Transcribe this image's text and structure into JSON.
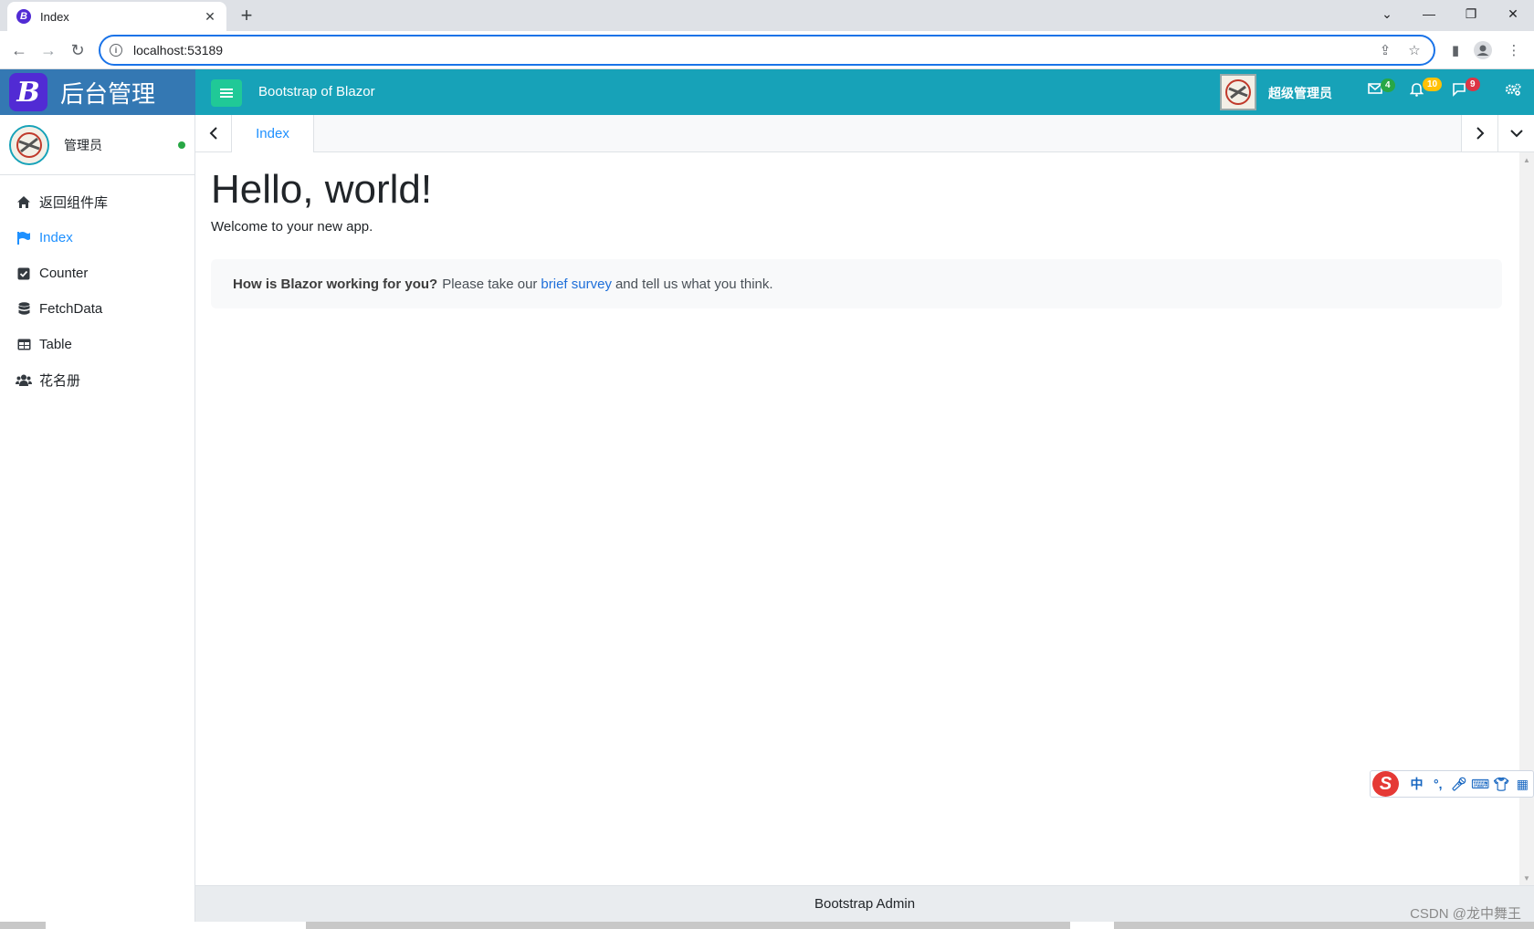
{
  "browser": {
    "tab_title": "Index",
    "favicon_letter": "B",
    "url": "localhost:53189"
  },
  "header": {
    "brand_letter": "B",
    "brand_title": "后台管理",
    "app_title": "Bootstrap of Blazor",
    "user_name": "超级管理员",
    "badges": {
      "messages": "4",
      "notifications": "10",
      "tasks": "9"
    },
    "colors": {
      "header_bg": "#17a2b8",
      "brand_bg": "#3478b3",
      "toggle_bg": "#20c997"
    }
  },
  "sidebar": {
    "user_name": "管理员",
    "items": [
      {
        "label": "返回组件库",
        "icon": "home-icon",
        "active": false
      },
      {
        "label": "Index",
        "icon": "flag-icon",
        "active": true
      },
      {
        "label": "Counter",
        "icon": "check-square-icon",
        "active": false
      },
      {
        "label": "FetchData",
        "icon": "database-icon",
        "active": false
      },
      {
        "label": "Table",
        "icon": "table-icon",
        "active": false
      },
      {
        "label": "花名册",
        "icon": "users-icon",
        "active": false
      }
    ]
  },
  "tabs": {
    "active_label": "Index"
  },
  "main": {
    "heading": "Hello, world!",
    "welcome": "Welcome to your new app.",
    "survey": {
      "question": "How is Blazor working for you?",
      "text_before": "Please take our",
      "link": "brief survey",
      "text_after": "and tell us what you think."
    }
  },
  "ime": {
    "logo": "S",
    "lang": "中"
  },
  "footer": {
    "text": "Bootstrap Admin"
  },
  "watermark": "CSDN @龙中舞王"
}
